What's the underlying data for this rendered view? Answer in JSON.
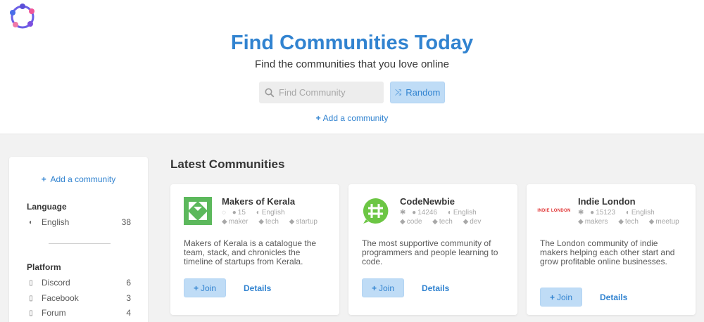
{
  "hero": {
    "title": "Find Communities Today",
    "subtitle": "Find the communities that you love online",
    "search_placeholder": "Find Community",
    "random_label": "Random",
    "add_label": "Add a community"
  },
  "sidebar": {
    "add_label": "Add a community",
    "language_heading": "Language",
    "languages": [
      {
        "label": "English",
        "count": "38",
        "icon": "globe-icon"
      }
    ],
    "platform_heading": "Platform",
    "platforms": [
      {
        "label": "Discord",
        "count": "6",
        "icon": "mobile-icon"
      },
      {
        "label": "Facebook",
        "count": "3",
        "icon": "mobile-icon"
      },
      {
        "label": "Forum",
        "count": "4",
        "icon": "mobile-icon"
      }
    ]
  },
  "main": {
    "title": "Latest Communities"
  },
  "cards": [
    {
      "name": "Makers of Kerala",
      "members": "15",
      "language": "English",
      "tags": [
        "maker",
        "tech",
        "startup"
      ],
      "description": "Makers of Kerala is a catalogue the team, stack, and chronicles the timeline of startups from Kerala.",
      "join_label": "Join",
      "details_label": "Details",
      "platform_icon": "whatsapp-icon"
    },
    {
      "name": "CodeNewbie",
      "members": "14246",
      "language": "English",
      "tags": [
        "code",
        "tech",
        "dev"
      ],
      "description": "The most supportive community of programmers and people learning to code.",
      "join_label": "Join",
      "details_label": "Details",
      "platform_icon": "slack-icon"
    },
    {
      "name": "Indie London",
      "members": "15123",
      "language": "English",
      "tags": [
        "makers",
        "tech",
        "meetup"
      ],
      "description": "The London community of indie makers helping each other start and grow profitable online businesses.",
      "join_label": "Join",
      "details_label": "Details",
      "platform_icon": "slack-icon",
      "logo_text": "INDIE LONDON"
    }
  ],
  "colors": {
    "accent": "#3183d0",
    "button_bg": "#bfdcf6",
    "page_bg": "#f2f2f2"
  }
}
